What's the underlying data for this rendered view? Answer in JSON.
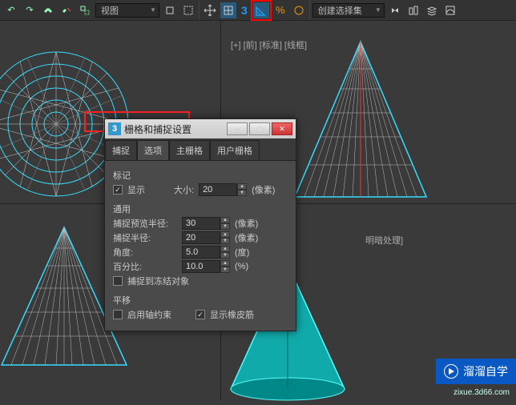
{
  "toolbar": {
    "view_label": "视图",
    "three_label": "3",
    "selection_set_placeholder": "创建选择集"
  },
  "viewport": {
    "top_right_label": "[+] [前] [标准] [线框]",
    "bottom_right_label": "明暗处理]"
  },
  "dialog": {
    "title": "栅格和捕捉设置",
    "tabs": [
      "捕捉",
      "选项",
      "主栅格",
      "用户栅格"
    ],
    "section_marker": "标记",
    "show_label": "显示",
    "size_label": "大小:",
    "size_value": "20",
    "size_unit": "(像素)",
    "section_general": "通用",
    "preview_radius_label": "捕捉预览半径:",
    "preview_radius_value": "30",
    "preview_radius_unit": "(像素)",
    "snap_radius_label": "捕捉半径:",
    "snap_radius_value": "20",
    "snap_radius_unit": "(像素)",
    "angle_label": "角度:",
    "angle_value": "5.0",
    "angle_unit": "(度)",
    "percent_label": "百分比:",
    "percent_value": "10.0",
    "percent_unit": "(%)",
    "frozen_label": "捕捉到冻结对象",
    "section_translate": "平移",
    "axis_constraint_label": "启用轴约束",
    "rubber_band_label": "显示橡皮筋"
  },
  "watermark": {
    "text": "溜溜自学",
    "url": "zixue.3d66.com"
  }
}
